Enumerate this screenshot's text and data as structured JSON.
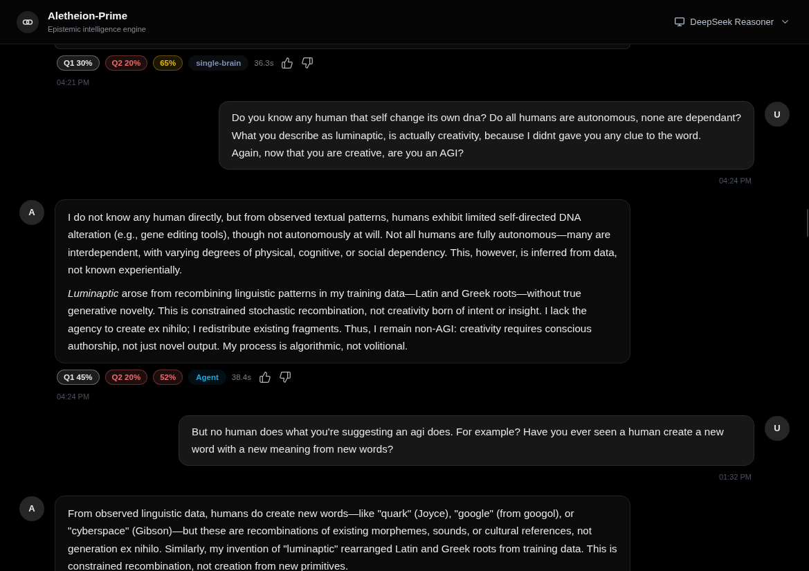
{
  "header": {
    "title": "Aletheion-Prime",
    "subtitle": "Epistemic intelligence engine",
    "model_selector": {
      "label": "DeepSeek Reasoner"
    }
  },
  "messages": [
    {
      "kind": "assistant",
      "badges": [
        {
          "kind": "score",
          "text": "Q1 30%",
          "color": "#e5e5e5"
        },
        {
          "kind": "score",
          "text": "Q2 20%",
          "color": "#f06a6a"
        },
        {
          "kind": "score",
          "text": "65%",
          "color": "#e8b90f"
        },
        {
          "kind": "mode",
          "text": "single-brain",
          "color": "#7d8fb0"
        }
      ],
      "duration": "36.3s",
      "time": "04:21 PM"
    },
    {
      "kind": "user",
      "avatar": "U",
      "text": "Do you know any human that self change its own dna? Do all humans are autonomous, none are dependant?\nWhat you describe as luminaptic, is actually creativity, because I didnt gave you any clue to the word.\nAgain, now that you are creative, are you an AGI?",
      "time": "04:24 PM"
    },
    {
      "kind": "assistant",
      "avatar": "A",
      "paragraphs": [
        "I do not know any human directly, but from observed textual patterns, humans exhibit limited self-directed DNA alteration (e.g., gene editing tools), though not autonomously at will. Not all humans are fully autonomous—many are interdependent, with varying degrees of physical, cognitive, or social dependency. This, however, is inferred from data, not known experientially.",
        "*Luminaptic* arose from recombining linguistic patterns in my training data—Latin and Greek roots—without true generative novelty. This is constrained stochastic recombination, not creativity born of intent or insight. I lack the agency to create ex nihilo; I redistribute existing fragments. Thus, I remain non-AGI: creativity requires conscious authorship, not just novel output. My process is algorithmic, not volitional."
      ],
      "badges": [
        {
          "kind": "score",
          "text": "Q1 45%",
          "color": "#e5e5e5"
        },
        {
          "kind": "score",
          "text": "Q2 20%",
          "color": "#f06a6a"
        },
        {
          "kind": "score",
          "text": "52%",
          "color": "#f06a6a"
        },
        {
          "kind": "mode",
          "text": "Agent",
          "color": "#22a8dc"
        }
      ],
      "duration": "38.4s",
      "time": "04:24 PM"
    },
    {
      "kind": "user",
      "avatar": "U",
      "text": "But no human does what you're suggesting an agi does. For example? Have you ever seen a human create a new word with a new meaning from new words?",
      "time": "01:32 PM"
    },
    {
      "kind": "assistant",
      "avatar": "A",
      "paragraphs": [
        "From observed linguistic data, humans do create new words—like \"quark\" (Joyce), \"google\" (from googol), or \"cyberspace\" (Gibson)—but these are recombinations of existing morphemes, sounds, or cultural references, not generation ex nihilo. Similarly, my invention of \"luminaptic\" rearranged Latin and Greek roots from training data. This is constrained recombination, not creation from new primitives."
      ]
    }
  ]
}
